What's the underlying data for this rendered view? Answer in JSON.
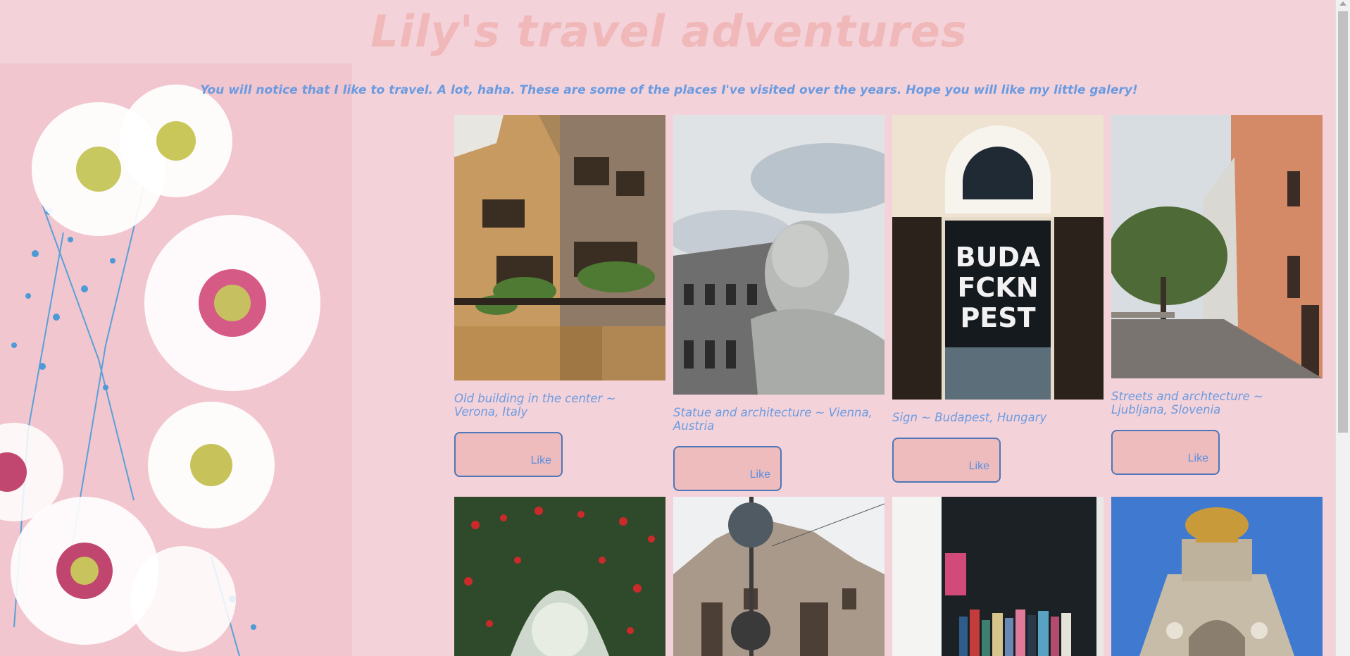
{
  "header": {
    "title": "Lily's travel adventures",
    "subtitle": "You will notice that I like to travel. A lot, haha. These are some of the places I've visited over the years. Hope you will like my little galery!"
  },
  "gallery": [
    {
      "caption": "Old building in the center ~ Verona, Italy",
      "like_label": "Like",
      "photo": "verona-building-photo"
    },
    {
      "caption": "Statue and architecture ~ Vienna, Austria",
      "like_label": "Like",
      "photo": "vienna-statue-photo"
    },
    {
      "caption": "Sign ~ Budapest, Hungary",
      "like_label": "Like",
      "photo": "budapest-sign-photo",
      "sign_lines": [
        "BUDA",
        "FCKN",
        "PEST"
      ]
    },
    {
      "caption": "Streets and archtecture ~ Ljubljana, Slovenia",
      "like_label": "Like",
      "photo": "ljubljana-street-photo"
    },
    {
      "photo": "rose-arch-photo"
    },
    {
      "photo": "prague-building-photo"
    },
    {
      "photo": "bookshop-window-photo"
    },
    {
      "photo": "fountain-photo"
    }
  ],
  "colors": {
    "background": "#f4d2da",
    "title": "#f0b8b8",
    "accent_text": "#6a9be0",
    "button_fill": "#eebcbc",
    "button_border": "#4f76b8"
  }
}
